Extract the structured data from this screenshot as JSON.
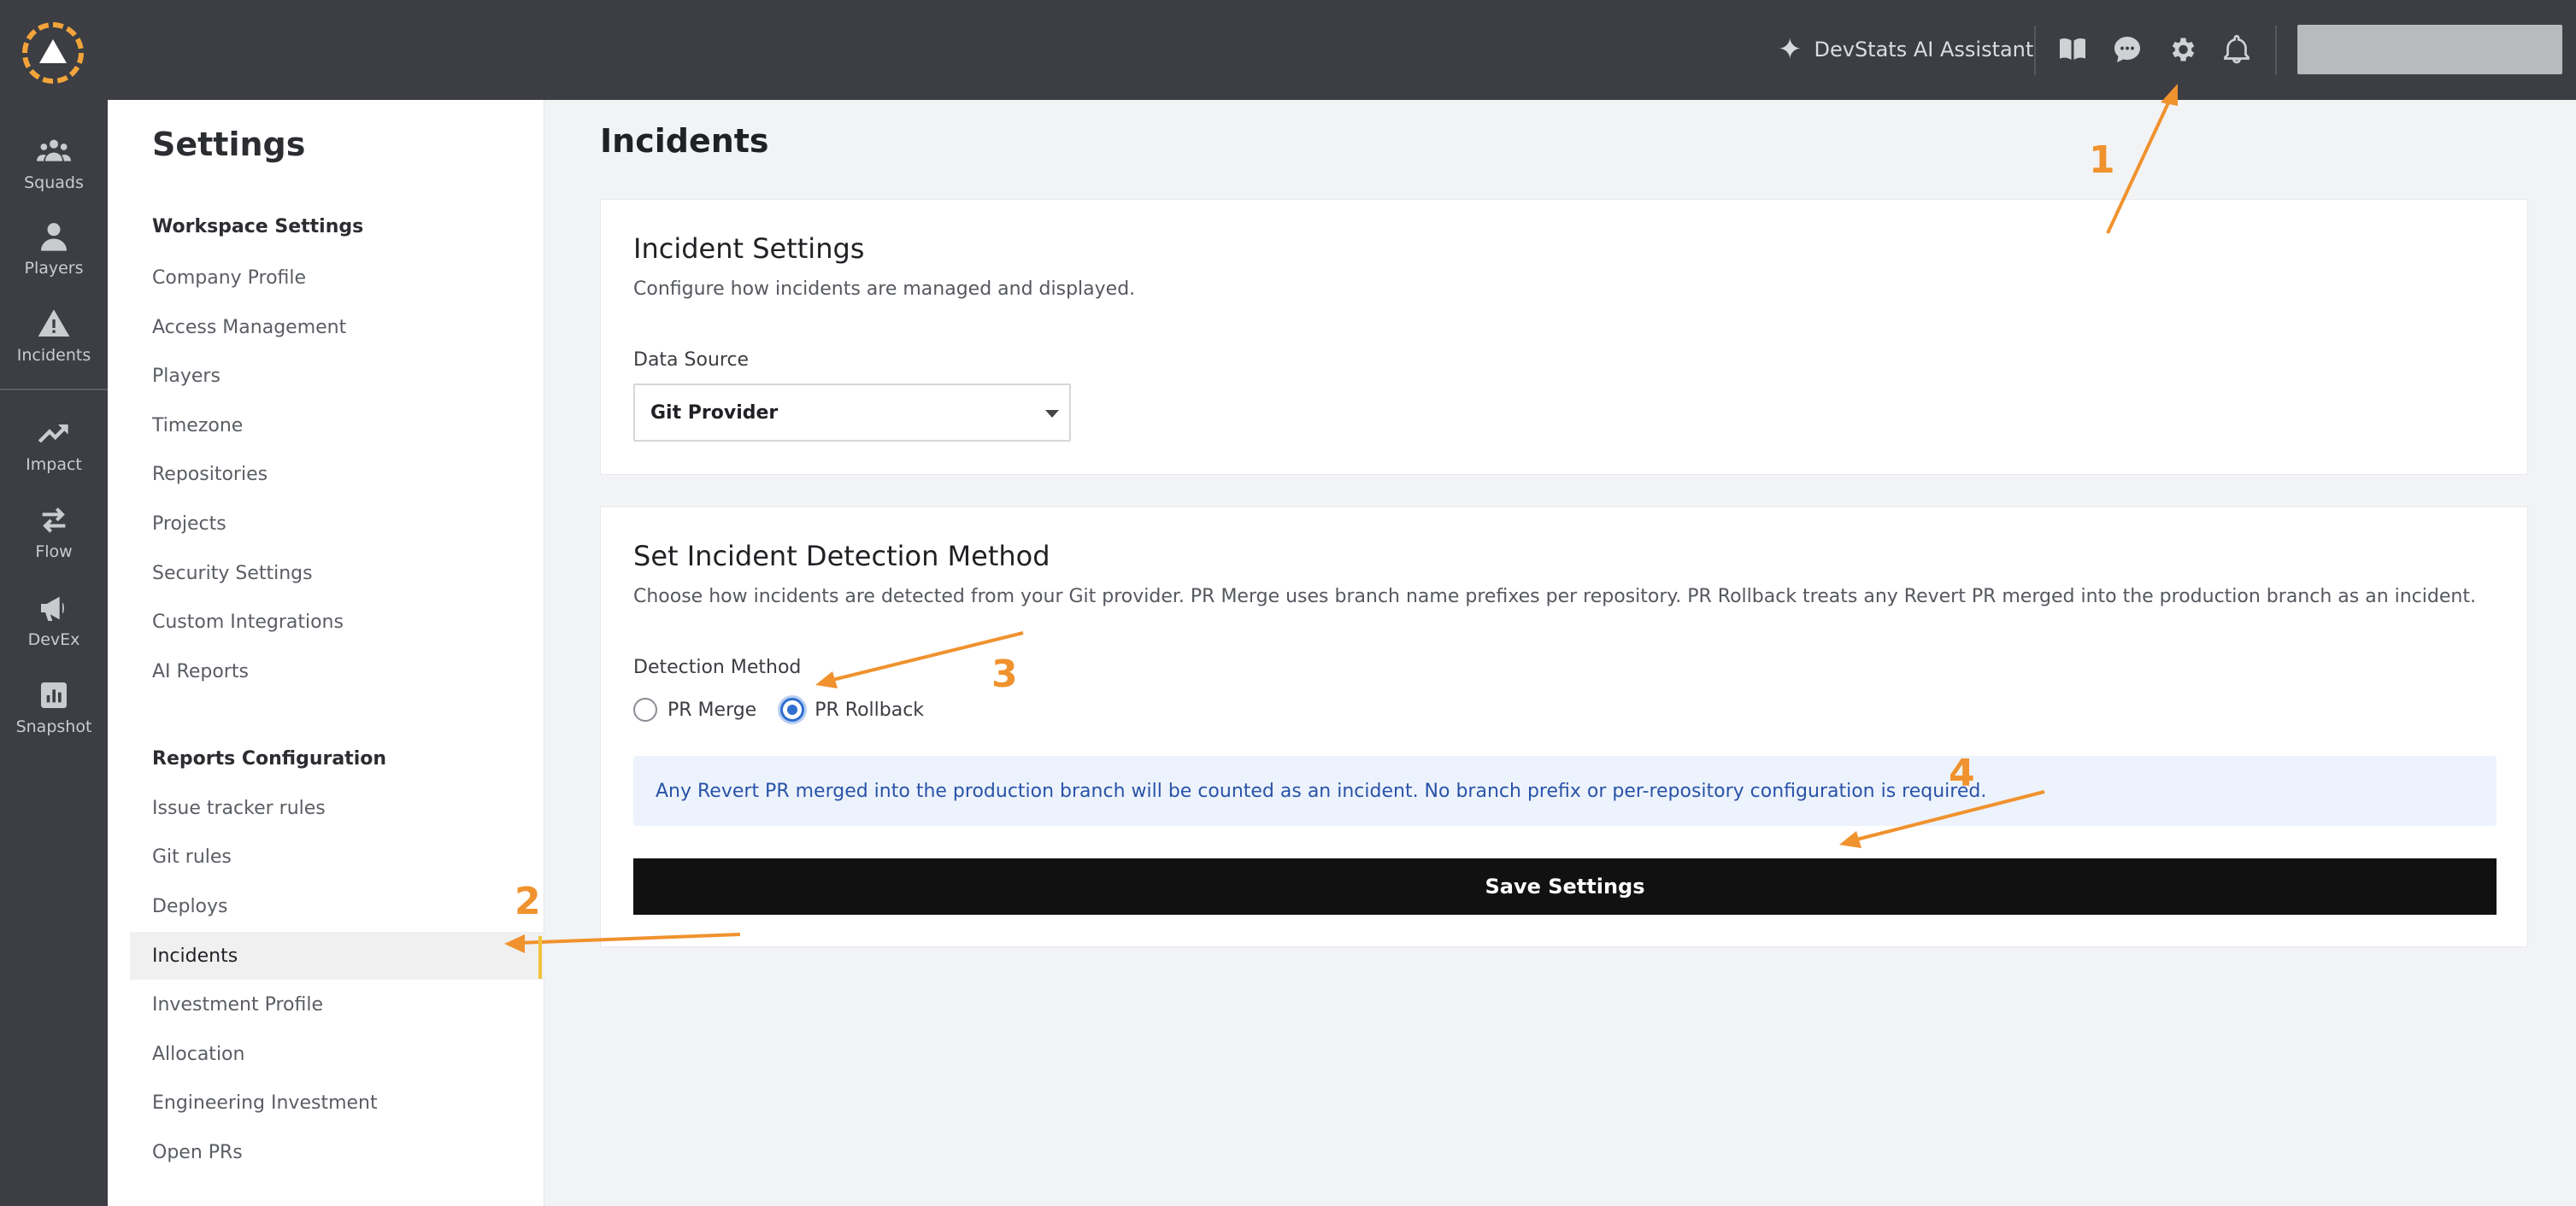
{
  "topbar": {
    "ai_assistant_label": "DevStats AI Assistant",
    "icons": [
      "book-icon",
      "chat-icon",
      "gear-icon",
      "bell-icon"
    ]
  },
  "rail": {
    "items": [
      {
        "label": "Squads",
        "icon": "squads-icon"
      },
      {
        "label": "Players",
        "icon": "player-icon"
      },
      {
        "label": "Incidents",
        "icon": "warning-icon"
      },
      {
        "label": "Impact",
        "icon": "trend-up-icon"
      },
      {
        "label": "Flow",
        "icon": "arrows-icon"
      },
      {
        "label": "DevEx",
        "icon": "megaphone-icon"
      },
      {
        "label": "Snapshot",
        "icon": "chart-icon"
      }
    ]
  },
  "settings_nav": {
    "title": "Settings",
    "workspace_heading": "Workspace Settings",
    "workspace_items": [
      "Company Profile",
      "Access Management",
      "Players",
      "Timezone",
      "Repositories",
      "Projects",
      "Security Settings",
      "Custom Integrations",
      "AI Reports"
    ],
    "reports_heading": "Reports Configuration",
    "reports_items": [
      "Issue tracker rules",
      "Git rules",
      "Deploys",
      "Incidents",
      "Investment Profile",
      "Allocation",
      "Engineering Investment",
      "Open PRs"
    ],
    "active_item": "Incidents"
  },
  "main": {
    "page_title": "Incidents",
    "incident_settings": {
      "title": "Incident Settings",
      "description": "Configure how incidents are managed and displayed.",
      "data_source_label": "Data Source",
      "data_source_value": "Git Provider"
    },
    "detection": {
      "title": "Set Incident Detection Method",
      "description": "Choose how incidents are detected from your Git provider. PR Merge uses branch name prefixes per repository. PR Rollback treats any Revert PR merged into the production branch as an incident.",
      "method_label": "Detection Method",
      "options": [
        "PR Merge",
        "PR Rollback"
      ],
      "selected": "PR Rollback",
      "info": "Any Revert PR merged into the production branch will be counted as an incident. No branch prefix or per-repository configuration is required.",
      "save_label": "Save Settings"
    }
  },
  "annotations": {
    "numbers": [
      "1",
      "2",
      "3",
      "4"
    ],
    "color": "#f0922e"
  },
  "colors": {
    "topbar": "#3c3e43",
    "accent_blue": "#2f6fd0",
    "save_button": "#111112",
    "info_bg": "#edf3fc"
  }
}
